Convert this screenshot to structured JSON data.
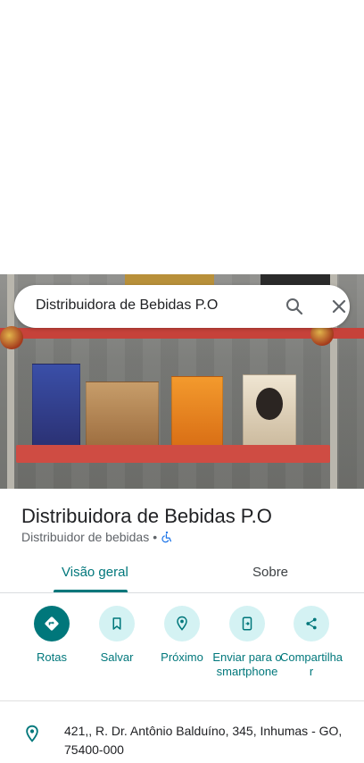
{
  "search": {
    "query": "Distribuidora de Bebidas P.O"
  },
  "place": {
    "name": "Distribuidora de Bebidas P.O",
    "category": "Distribuidor de bebidas",
    "separator": "•"
  },
  "tabs": [
    {
      "label": "Visão geral",
      "active": true
    },
    {
      "label": "Sobre",
      "active": false
    }
  ],
  "actions": [
    {
      "label": "Rotas",
      "icon": "directions-icon"
    },
    {
      "label": "Salvar",
      "icon": "bookmark-icon"
    },
    {
      "label": "Próximo",
      "icon": "nearby-icon"
    },
    {
      "label": "Enviar para o smartphone",
      "icon": "send-to-phone-icon"
    },
    {
      "label": "Compartilhar",
      "icon": "share-icon"
    }
  ],
  "address": "421,, R. Dr. Antônio Balduíno, 345, Inhumas - GO, 75400-000",
  "colors": {
    "accent": "#00777b",
    "accent_light": "#d4f2f3",
    "wheelchair": "#1a73e8"
  }
}
